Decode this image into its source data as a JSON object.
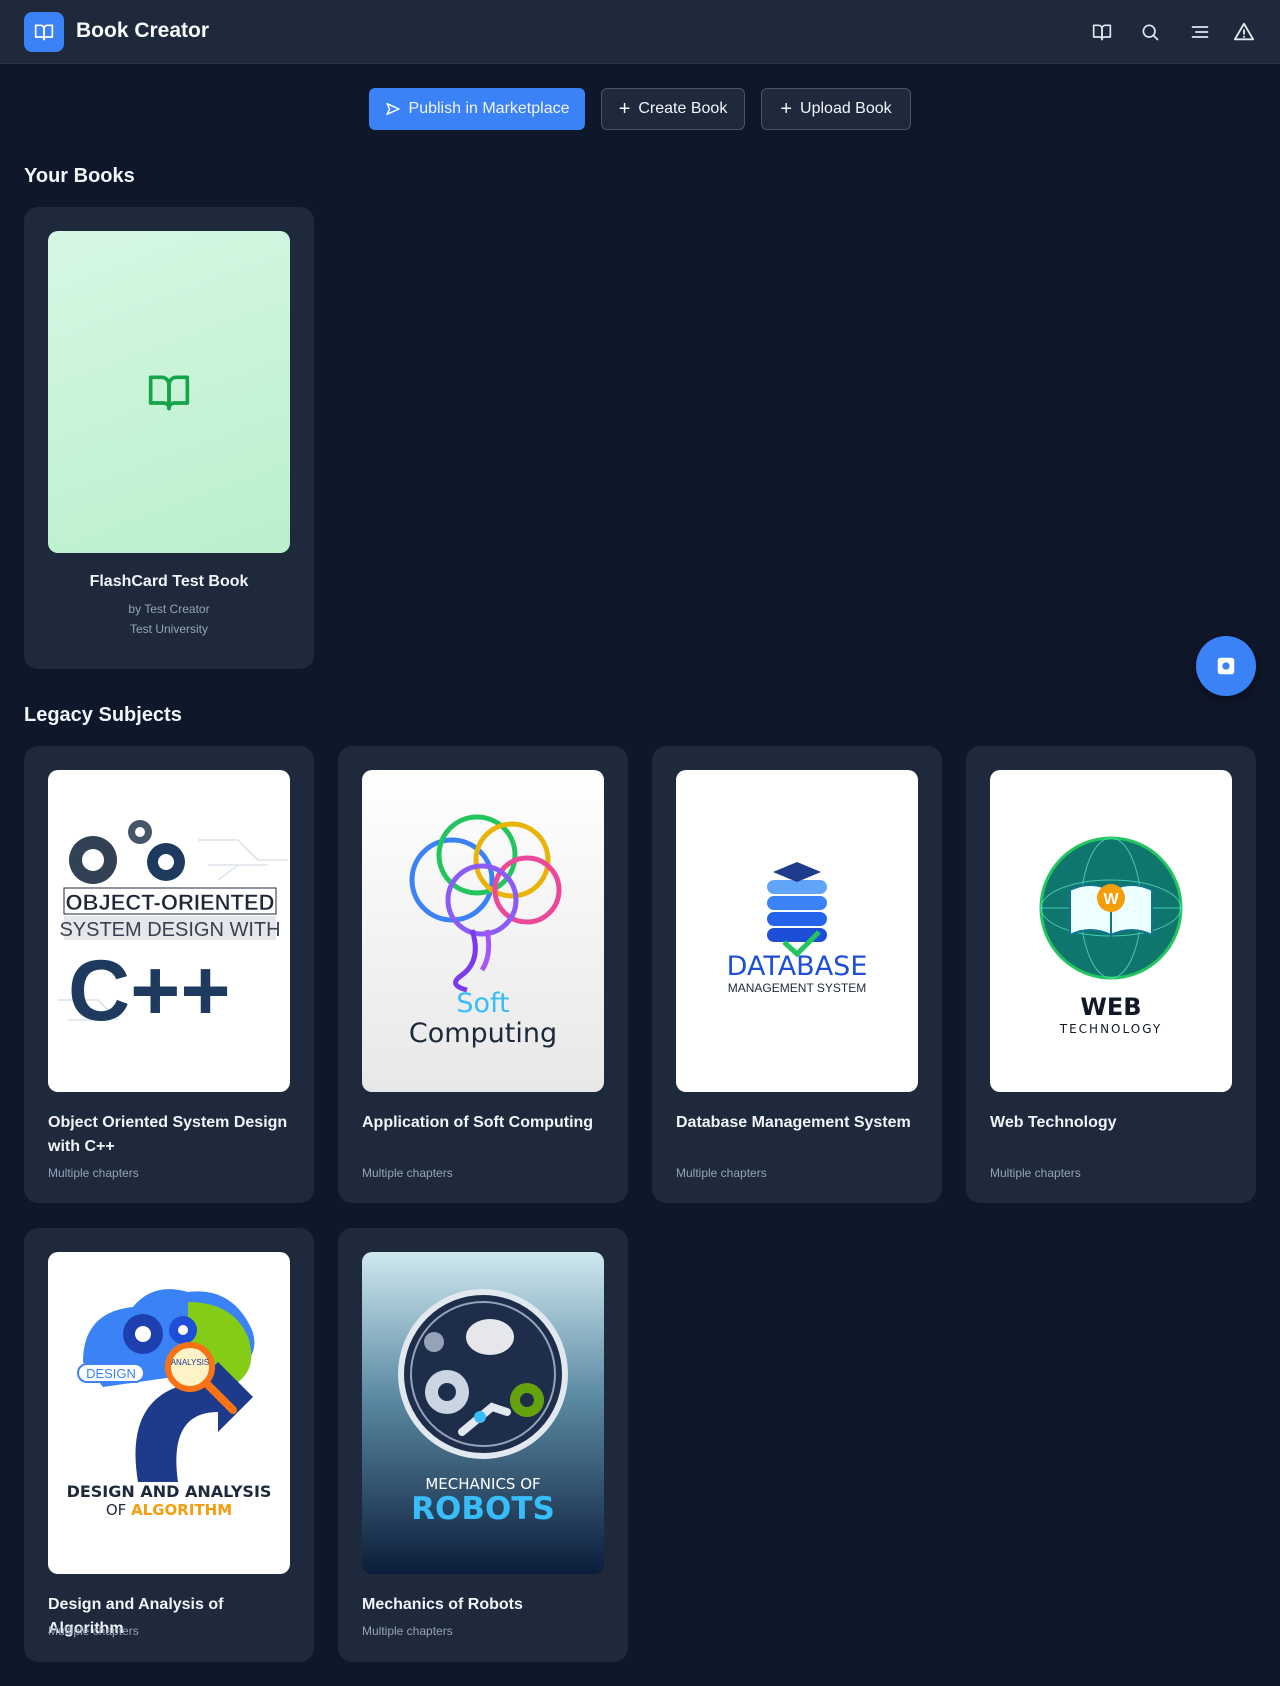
{
  "app": {
    "title": "Book Creator"
  },
  "toolbar": {
    "publish_label": "Publish in Marketplace",
    "create_label": "Create Book",
    "upload_label": "Upload Book"
  },
  "sections": {
    "your_books": "Your Books",
    "legacy": "Legacy Subjects"
  },
  "your_books": [
    {
      "title": "FlashCard Test Book",
      "author": "by Test Creator",
      "institution": "Test University"
    }
  ],
  "legacy_subjects": [
    {
      "title": "Object Oriented System Design with C++",
      "meta": "Multiple chapters",
      "cover_text": [
        "OBJECT-ORIENTED",
        "SYSTEM DESIGN WITH",
        "C++"
      ]
    },
    {
      "title": "Application of Soft Computing",
      "meta": "Multiple chapters",
      "cover_text": [
        "Soft",
        "Computing"
      ]
    },
    {
      "title": "Database Management System",
      "meta": "Multiple chapters",
      "cover_text": [
        "DATABASE",
        "MANAGEMENT SYSTEM"
      ]
    },
    {
      "title": "Web Technology",
      "meta": "Multiple chapters",
      "cover_text": [
        "WEB",
        "TECHNOLOGY"
      ]
    },
    {
      "title": "Design and Analysis of Algorithm",
      "meta": "Multiple chapters",
      "cover_text": [
        "DESIGN AND ANALYSIS",
        "OF",
        "ALGORITHM",
        "DESIGN",
        "ANALYSIS"
      ]
    },
    {
      "title": "Mechanics of Robots",
      "meta": "Multiple chapters",
      "cover_text": [
        "MECHANICS OF",
        "ROBOTS"
      ]
    }
  ],
  "icons": {
    "logo": "book-open-icon",
    "header": [
      "book-open-icon",
      "search-icon",
      "menu-icon",
      "alert-triangle-icon"
    ],
    "fab": "camera-icon"
  },
  "colors": {
    "background": "#0f172a",
    "surface": "#1e293b",
    "accent": "#3b82f6",
    "flashcard_cover": "#c9f5d8",
    "flashcard_icon": "#16a34a"
  }
}
